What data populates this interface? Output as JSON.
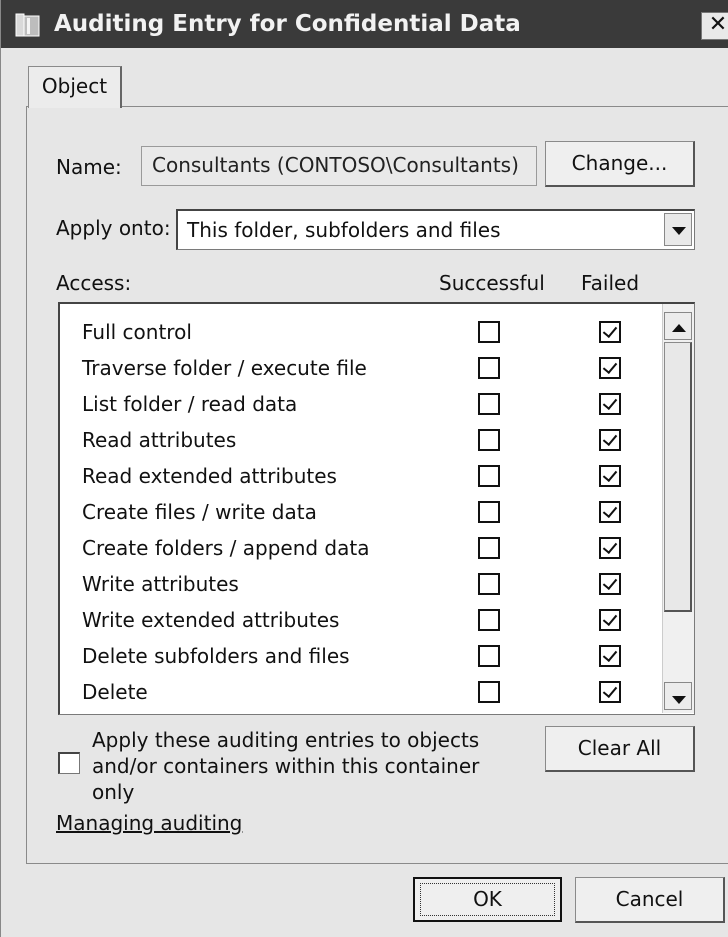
{
  "window": {
    "title": "Auditing Entry for Confidential Data",
    "close_glyph": "✕"
  },
  "tabs": [
    {
      "label": "Object"
    }
  ],
  "name": {
    "label": "Name:",
    "value": "Consultants (CONTOSO\\Consultants)",
    "change_button": "Change..."
  },
  "apply_onto": {
    "label": "Apply onto:",
    "selected": "This folder, subfolders and files"
  },
  "access": {
    "label": "Access:",
    "col_successful": "Successful",
    "col_failed": "Failed",
    "rows": [
      {
        "label": "Full control",
        "successful": false,
        "failed": true
      },
      {
        "label": "Traverse folder / execute file",
        "successful": false,
        "failed": true
      },
      {
        "label": "List folder / read data",
        "successful": false,
        "failed": true
      },
      {
        "label": "Read attributes",
        "successful": false,
        "failed": true
      },
      {
        "label": "Read extended attributes",
        "successful": false,
        "failed": true
      },
      {
        "label": "Create files / write data",
        "successful": false,
        "failed": true
      },
      {
        "label": "Create folders / append data",
        "successful": false,
        "failed": true
      },
      {
        "label": "Write attributes",
        "successful": false,
        "failed": true
      },
      {
        "label": "Write extended attributes",
        "successful": false,
        "failed": true
      },
      {
        "label": "Delete subfolders and files",
        "successful": false,
        "failed": true
      },
      {
        "label": "Delete",
        "successful": false,
        "failed": true
      }
    ]
  },
  "apply_container": {
    "label": "Apply these auditing entries to objects and/or containers within this container only",
    "checked": false
  },
  "clear_all_button": "Clear All",
  "managing_link": "Managing auditing",
  "ok_button": "OK",
  "cancel_button": "Cancel"
}
